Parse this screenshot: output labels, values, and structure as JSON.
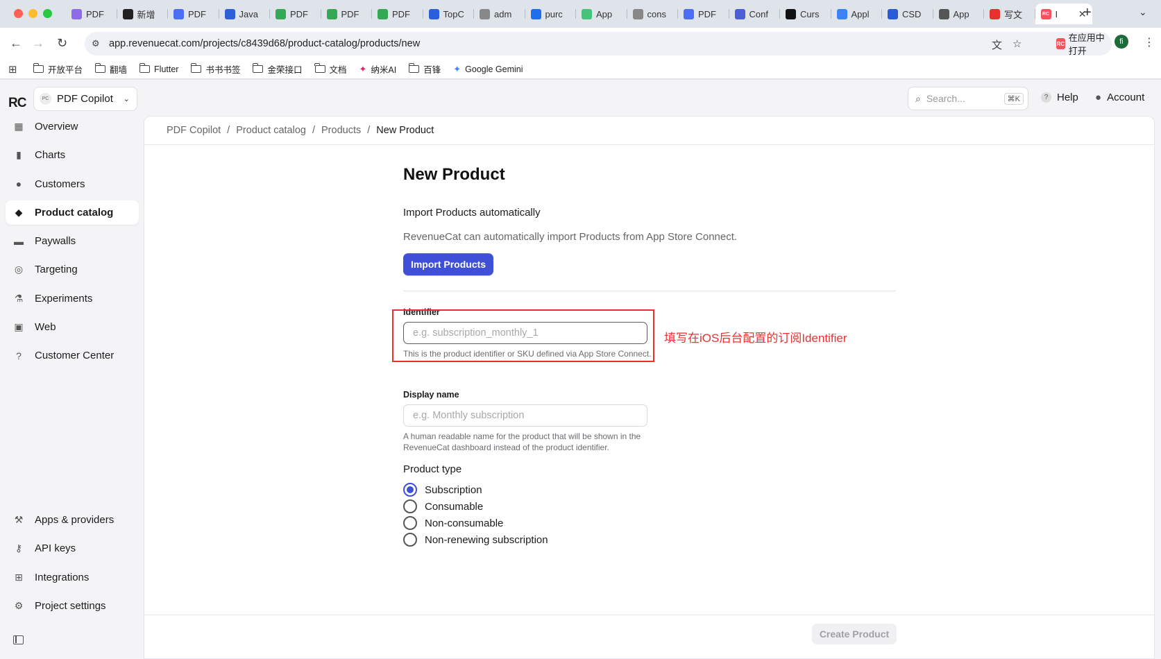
{
  "browser": {
    "tabs": [
      {
        "label": "PDF",
        "color": "#8e6be8"
      },
      {
        "label": "新增",
        "color": "#222222"
      },
      {
        "label": "PDF",
        "color": "#4c6ef5"
      },
      {
        "label": "Java",
        "color": "#2d5fd6"
      },
      {
        "label": "PDF",
        "color": "#34a853"
      },
      {
        "label": "PDF",
        "color": "#34a853"
      },
      {
        "label": "PDF",
        "color": "#34a853"
      },
      {
        "label": "TopC",
        "color": "#2b5fe0"
      },
      {
        "label": "adm",
        "color": "#888888"
      },
      {
        "label": "purc",
        "color": "#1f6feb"
      },
      {
        "label": "App",
        "color": "#46c37b"
      },
      {
        "label": "cons",
        "color": "#888888"
      },
      {
        "label": "PDF",
        "color": "#4c6ef5"
      },
      {
        "label": "Conf",
        "color": "#4c5fd5"
      },
      {
        "label": "Curs",
        "color": "#111111"
      },
      {
        "label": "Appl",
        "color": "#3b82f6"
      },
      {
        "label": "CSD",
        "color": "#2a5bd7"
      },
      {
        "label": "App",
        "color": "#555555"
      },
      {
        "label": "写文",
        "color": "#e8312f"
      }
    ],
    "active_tab": {
      "label": "I",
      "color": "#f2545b"
    },
    "url": "app.revenuecat.com/projects/c8439d68/product-catalog/products/new",
    "open_in_app": "在应用中打开",
    "profile_initial": "fi",
    "bookmarks": [
      {
        "label": "开放平台",
        "type": "folder"
      },
      {
        "label": "翻墙",
        "type": "folder"
      },
      {
        "label": "Flutter",
        "type": "folder"
      },
      {
        "label": "书书书签",
        "type": "folder"
      },
      {
        "label": "金荣接口",
        "type": "folder"
      },
      {
        "label": "文档",
        "type": "folder"
      },
      {
        "label": "纳米AI",
        "type": "site"
      },
      {
        "label": "百锋",
        "type": "folder"
      },
      {
        "label": "Google Gemini",
        "type": "site"
      }
    ]
  },
  "app": {
    "logo": "RC",
    "project": {
      "badge": "PC",
      "name": "PDF Copilot"
    },
    "sidebar_top": [
      {
        "label": "Overview",
        "icon": "overview-icon"
      },
      {
        "label": "Charts",
        "icon": "charts-icon"
      },
      {
        "label": "Customers",
        "icon": "customers-icon"
      },
      {
        "label": "Product catalog",
        "icon": "tag-icon",
        "active": true
      },
      {
        "label": "Paywalls",
        "icon": "paywalls-icon"
      },
      {
        "label": "Targeting",
        "icon": "targeting-icon"
      },
      {
        "label": "Experiments",
        "icon": "flask-icon"
      },
      {
        "label": "Web",
        "icon": "web-icon"
      },
      {
        "label": "Customer Center",
        "icon": "help-circle-icon"
      }
    ],
    "sidebar_bottom": [
      {
        "label": "Apps & providers",
        "icon": "hammer-icon"
      },
      {
        "label": "API keys",
        "icon": "key-icon"
      },
      {
        "label": "Integrations",
        "icon": "grid-icon"
      },
      {
        "label": "Project settings",
        "icon": "gear-icon"
      }
    ],
    "search": {
      "placeholder": "Search...",
      "shortcut": "⌘K"
    },
    "help_label": "Help",
    "account_label": "Account",
    "accent_color": "#3f4fd8"
  },
  "breadcrumb": [
    "PDF Copilot",
    "Product catalog",
    "Products",
    "New Product"
  ],
  "form": {
    "title": "New Product",
    "import_heading": "Import Products automatically",
    "import_description": "RevenueCat can automatically import Products from App Store Connect.",
    "import_button": "Import Products",
    "identifier": {
      "label": "Identifier",
      "placeholder": "e.g. subscription_monthly_1",
      "value": "",
      "help": "This is the product identifier or SKU defined via App Store Connect."
    },
    "display_name": {
      "label": "Display name",
      "placeholder": "e.g. Monthly subscription",
      "value": "",
      "help": "A human readable name for the product that will be shown in the RevenueCat dashboard instead of the product identifier."
    },
    "product_type": {
      "label": "Product type",
      "options": [
        "Subscription",
        "Consumable",
        "Non-consumable",
        "Non-renewing subscription"
      ],
      "selected": "Subscription"
    },
    "create_button": "Create Product"
  },
  "annotation": {
    "text": "填写在iOS后台配置的订阅Identifier",
    "color": "#e8312f"
  }
}
